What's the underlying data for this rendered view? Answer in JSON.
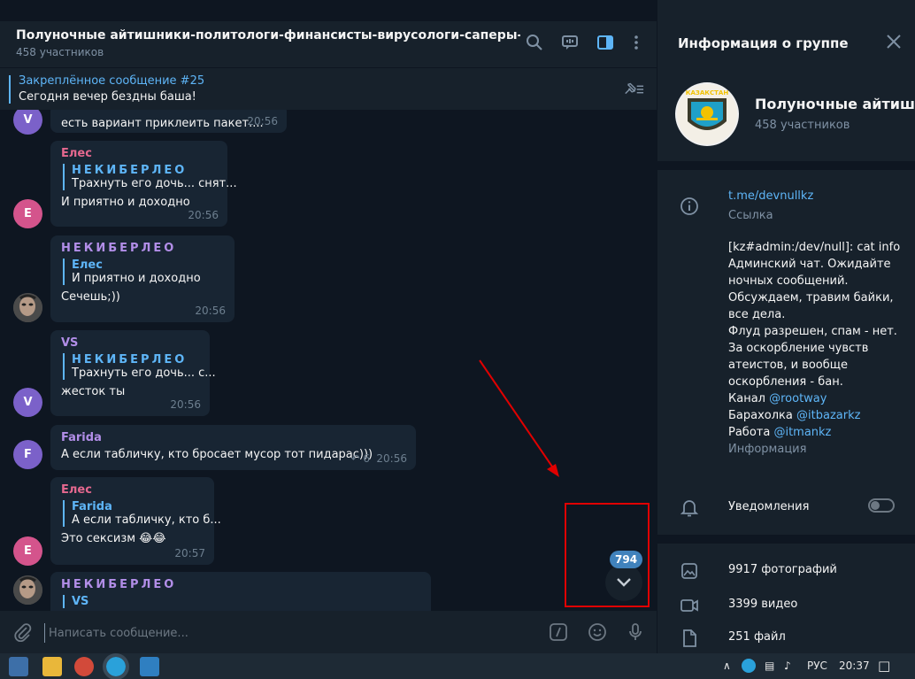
{
  "chat": {
    "title": "Полуночные айтишники-политологи-финансисты-вирусологи-саперы-химики-биоло",
    "members": "458 участников",
    "pinned": {
      "title": "Закреплённое сообщение #25",
      "text": "Сегодня вечер бездны баша!"
    },
    "messages": [
      {
        "avatar_letter": "V",
        "avatar_color": "#7b61c9",
        "text": "есть вариант приклеить пакет....",
        "time": "20:56"
      },
      {
        "author": "Елес",
        "author_color": "#e5688f",
        "avatar_letter": "Е",
        "avatar_color": "#d4548c",
        "reply_author": "НЕКИБЕРЛЕО",
        "reply_text": "Трахнуть его дочь... снят...",
        "text": "И приятно и доходно",
        "time": "20:56"
      },
      {
        "author": "НЕКИБЕРЛЕО",
        "author_color": "#b28ee8",
        "reply_author": "Елес",
        "reply_text": "И приятно и доходно",
        "text": "Сечешь;))",
        "time": "20:56"
      },
      {
        "author": "VS",
        "author_color": "#b28ee8",
        "avatar_letter": "V",
        "avatar_color": "#7b61c9",
        "reply_author": "НЕКИБЕРЛЕО",
        "reply_text": "Трахнуть его дочь... с...",
        "text": "жесток ты",
        "time": "20:56"
      },
      {
        "author": "Farida",
        "author_color": "#b28ee8",
        "avatar_letter": "F",
        "avatar_color": "#7b61c9",
        "text": "А если табличку, кто бросает мусор тот пидарас)))",
        "replies": "6",
        "time": "20:56"
      },
      {
        "author": "Елес",
        "author_color": "#e5688f",
        "avatar_letter": "Е",
        "avatar_color": "#d4548c",
        "reply_author": "Farida",
        "reply_text": "А если табличку, кто б...",
        "text": "Это сексизм 😂😂",
        "time": "20:57"
      },
      {
        "author": "НЕКИБЕРЛЕО",
        "author_color": "#b28ee8",
        "reply_author": "VS"
      }
    ],
    "unread_count": "794",
    "composer_placeholder": "Написать сообщение..."
  },
  "panel": {
    "title": "Информация о группе",
    "group_name": "Полуночные айтишники-политологи-финансисты-вирусологи-саперы-химики-биологи",
    "members": "458 участников",
    "avatar_text": "КАЗАКСТАН",
    "link": "t.me/devnullkz",
    "link_label": "Ссылка",
    "description_lines": [
      "[kz#admin:/dev/null]: cat info",
      "Админский чат. Ожидайте",
      "ночных сообщений.",
      "Обсуждаем, травим байки,",
      "все дела.",
      "Флуд разрешен, спам - нет.",
      "За оскорбление чувств",
      "атеистов, и вообще",
      "оскорбления - бан."
    ],
    "channel_prefix": "Канал ",
    "channel_link": "@rootway",
    "flea_prefix": "Барахолка ",
    "flea_link": "@itbazarkz",
    "job_prefix": "Работа ",
    "job_link": "@itmankz",
    "description_label": "Информация",
    "notifications_label": "Уведомления",
    "notifications_on": false,
    "media": [
      {
        "icon": "photo-icon",
        "text": "9917 фотографий"
      },
      {
        "icon": "video-icon",
        "text": "3399 видео"
      },
      {
        "icon": "file-icon",
        "text": "251 файл"
      }
    ]
  },
  "taskbar": {
    "language": "РУС",
    "time": "20:37"
  },
  "colors": {
    "accent": "#5eb5f7",
    "highlight": "#e00000",
    "badge": "#4082bc"
  }
}
